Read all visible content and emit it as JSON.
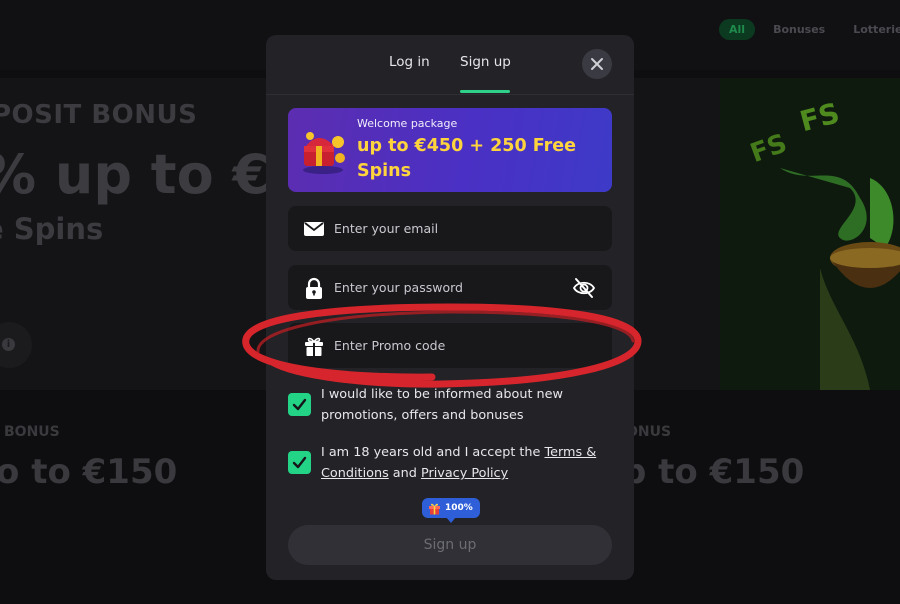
{
  "background": {
    "pills": [
      {
        "label": "All",
        "active": true
      },
      {
        "label": "Bonuses",
        "active": false
      },
      {
        "label": "Lotteries",
        "active": false
      }
    ],
    "hero": {
      "title_small": "POSIT BONUS",
      "title_big": "% up to €",
      "title_mid": "e Spins"
    },
    "card_left": {
      "label": "BONUS",
      "amount": "o to €150"
    },
    "card_right": {
      "label": "ONUS",
      "amount": "p to €150"
    }
  },
  "modal": {
    "tabs": [
      {
        "label": "Log in",
        "active": false
      },
      {
        "label": "Sign up",
        "active": true
      }
    ],
    "welcome": {
      "label": "Welcome package",
      "offer": "up to €450 + 250 Free Spins"
    },
    "email_field": {
      "placeholder": "Enter your email",
      "value": "",
      "icon": "envelope-icon"
    },
    "password_field": {
      "placeholder": "Enter your password",
      "value": "",
      "icon": "lock-icon",
      "toggle_icon": "eye-off-icon"
    },
    "promo_field": {
      "placeholder": "Enter Promo code",
      "value": "",
      "icon": "gift-icon"
    },
    "newsletter_checkbox": {
      "checked": true,
      "text": "I would like to be informed about new promotions, offers and bonuses"
    },
    "terms_checkbox": {
      "checked": true,
      "text_before": "I am 18 years old and I accept the ",
      "terms_link": "Terms & Conditions",
      "text_and": " and ",
      "privacy_link": "Privacy Policy"
    },
    "badge": {
      "text": "100%",
      "icon": "gift-icon"
    },
    "signup_button": {
      "label": "Sign up",
      "enabled": false
    }
  },
  "colors": {
    "accent_green": "#23d487",
    "promo_yellow": "#ffd43d",
    "annotation_red": "#e0262c",
    "badge_blue": "#2e5fd8"
  }
}
